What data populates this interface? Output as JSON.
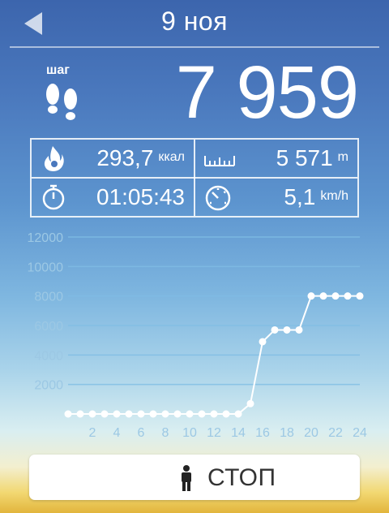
{
  "header": {
    "date": "9 ноя",
    "back_icon": "back-arrow-icon"
  },
  "summary": {
    "steps_label": "шаг",
    "steps": "7 959"
  },
  "stats": {
    "calories": {
      "value": "293,7",
      "unit": "ккал",
      "icon": "flame-icon"
    },
    "distance": {
      "value": "5 571",
      "unit": "m",
      "icon": "ruler-icon"
    },
    "duration": {
      "value": "01:05:43",
      "icon": "stopwatch-icon"
    },
    "speed": {
      "value": "5,1",
      "unit": "km/h",
      "icon": "speedometer-icon"
    }
  },
  "chart_data": {
    "type": "line",
    "x": [
      0,
      1,
      2,
      3,
      4,
      5,
      6,
      7,
      8,
      9,
      10,
      11,
      12,
      13,
      14,
      15,
      16,
      17,
      18,
      19,
      20,
      21,
      22,
      23,
      24
    ],
    "y": [
      0,
      0,
      0,
      0,
      0,
      0,
      0,
      0,
      0,
      0,
      0,
      0,
      0,
      0,
      0,
      700,
      4900,
      5700,
      5700,
      5700,
      8000,
      8000,
      8000,
      8000,
      8000
    ],
    "xticks": [
      2,
      4,
      6,
      8,
      10,
      12,
      14,
      16,
      18,
      20,
      22,
      24
    ],
    "yticks": [
      2000,
      4000,
      6000,
      8000,
      10000,
      12000
    ],
    "xlim": [
      0,
      24
    ],
    "ylim": [
      0,
      12000
    ],
    "grid": true
  },
  "controls": {
    "stop_label": "СТОП",
    "stop_icon": "person-icon"
  },
  "colors": {
    "line": "#ffffff",
    "tick_label": "#9cc8e4",
    "plot_bg": "#e8f3f6"
  }
}
